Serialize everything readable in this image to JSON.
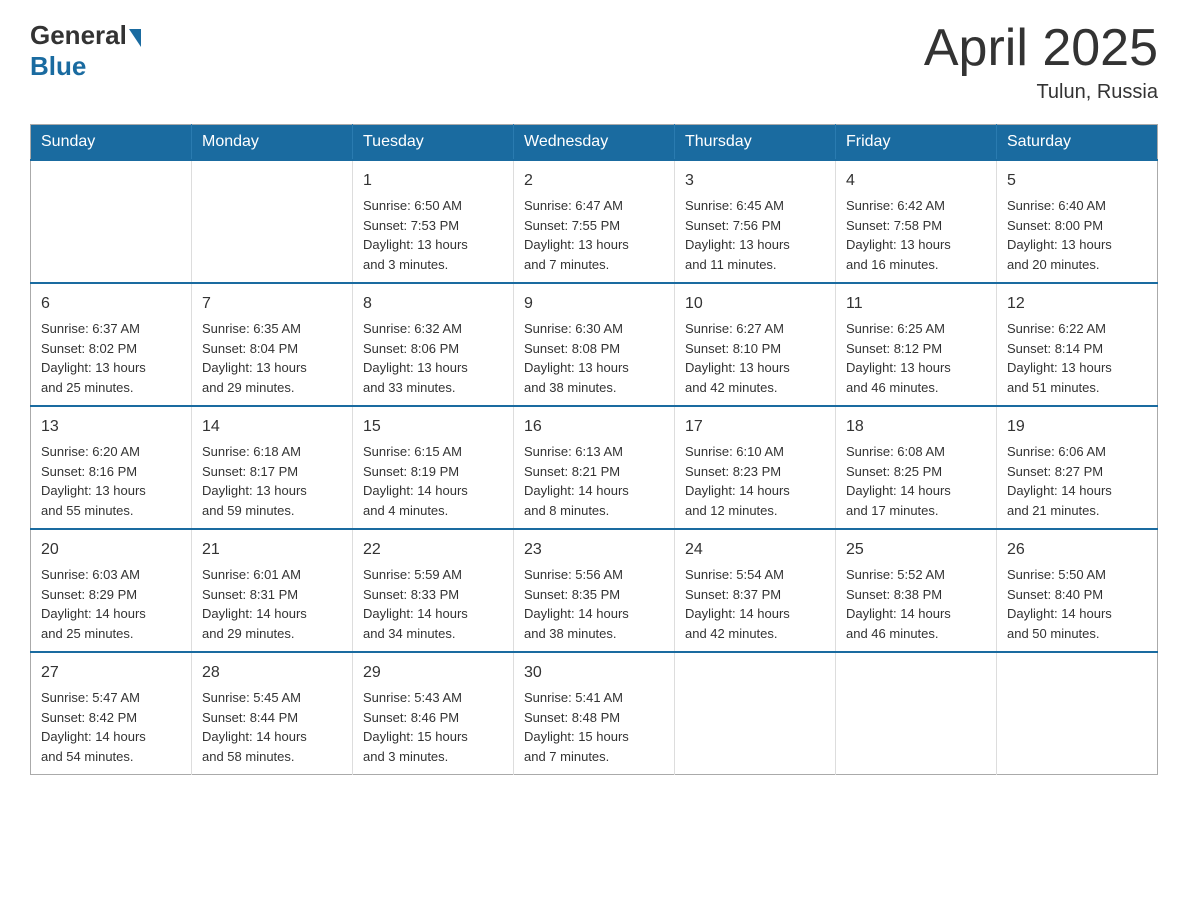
{
  "header": {
    "logo": {
      "general": "General",
      "blue": "Blue"
    },
    "title": "April 2025",
    "location": "Tulun, Russia"
  },
  "weekdays": [
    "Sunday",
    "Monday",
    "Tuesday",
    "Wednesday",
    "Thursday",
    "Friday",
    "Saturday"
  ],
  "weeks": [
    [
      {
        "day": "",
        "info": ""
      },
      {
        "day": "",
        "info": ""
      },
      {
        "day": "1",
        "info": "Sunrise: 6:50 AM\nSunset: 7:53 PM\nDaylight: 13 hours\nand 3 minutes."
      },
      {
        "day": "2",
        "info": "Sunrise: 6:47 AM\nSunset: 7:55 PM\nDaylight: 13 hours\nand 7 minutes."
      },
      {
        "day": "3",
        "info": "Sunrise: 6:45 AM\nSunset: 7:56 PM\nDaylight: 13 hours\nand 11 minutes."
      },
      {
        "day": "4",
        "info": "Sunrise: 6:42 AM\nSunset: 7:58 PM\nDaylight: 13 hours\nand 16 minutes."
      },
      {
        "day": "5",
        "info": "Sunrise: 6:40 AM\nSunset: 8:00 PM\nDaylight: 13 hours\nand 20 minutes."
      }
    ],
    [
      {
        "day": "6",
        "info": "Sunrise: 6:37 AM\nSunset: 8:02 PM\nDaylight: 13 hours\nand 25 minutes."
      },
      {
        "day": "7",
        "info": "Sunrise: 6:35 AM\nSunset: 8:04 PM\nDaylight: 13 hours\nand 29 minutes."
      },
      {
        "day": "8",
        "info": "Sunrise: 6:32 AM\nSunset: 8:06 PM\nDaylight: 13 hours\nand 33 minutes."
      },
      {
        "day": "9",
        "info": "Sunrise: 6:30 AM\nSunset: 8:08 PM\nDaylight: 13 hours\nand 38 minutes."
      },
      {
        "day": "10",
        "info": "Sunrise: 6:27 AM\nSunset: 8:10 PM\nDaylight: 13 hours\nand 42 minutes."
      },
      {
        "day": "11",
        "info": "Sunrise: 6:25 AM\nSunset: 8:12 PM\nDaylight: 13 hours\nand 46 minutes."
      },
      {
        "day": "12",
        "info": "Sunrise: 6:22 AM\nSunset: 8:14 PM\nDaylight: 13 hours\nand 51 minutes."
      }
    ],
    [
      {
        "day": "13",
        "info": "Sunrise: 6:20 AM\nSunset: 8:16 PM\nDaylight: 13 hours\nand 55 minutes."
      },
      {
        "day": "14",
        "info": "Sunrise: 6:18 AM\nSunset: 8:17 PM\nDaylight: 13 hours\nand 59 minutes."
      },
      {
        "day": "15",
        "info": "Sunrise: 6:15 AM\nSunset: 8:19 PM\nDaylight: 14 hours\nand 4 minutes."
      },
      {
        "day": "16",
        "info": "Sunrise: 6:13 AM\nSunset: 8:21 PM\nDaylight: 14 hours\nand 8 minutes."
      },
      {
        "day": "17",
        "info": "Sunrise: 6:10 AM\nSunset: 8:23 PM\nDaylight: 14 hours\nand 12 minutes."
      },
      {
        "day": "18",
        "info": "Sunrise: 6:08 AM\nSunset: 8:25 PM\nDaylight: 14 hours\nand 17 minutes."
      },
      {
        "day": "19",
        "info": "Sunrise: 6:06 AM\nSunset: 8:27 PM\nDaylight: 14 hours\nand 21 minutes."
      }
    ],
    [
      {
        "day": "20",
        "info": "Sunrise: 6:03 AM\nSunset: 8:29 PM\nDaylight: 14 hours\nand 25 minutes."
      },
      {
        "day": "21",
        "info": "Sunrise: 6:01 AM\nSunset: 8:31 PM\nDaylight: 14 hours\nand 29 minutes."
      },
      {
        "day": "22",
        "info": "Sunrise: 5:59 AM\nSunset: 8:33 PM\nDaylight: 14 hours\nand 34 minutes."
      },
      {
        "day": "23",
        "info": "Sunrise: 5:56 AM\nSunset: 8:35 PM\nDaylight: 14 hours\nand 38 minutes."
      },
      {
        "day": "24",
        "info": "Sunrise: 5:54 AM\nSunset: 8:37 PM\nDaylight: 14 hours\nand 42 minutes."
      },
      {
        "day": "25",
        "info": "Sunrise: 5:52 AM\nSunset: 8:38 PM\nDaylight: 14 hours\nand 46 minutes."
      },
      {
        "day": "26",
        "info": "Sunrise: 5:50 AM\nSunset: 8:40 PM\nDaylight: 14 hours\nand 50 minutes."
      }
    ],
    [
      {
        "day": "27",
        "info": "Sunrise: 5:47 AM\nSunset: 8:42 PM\nDaylight: 14 hours\nand 54 minutes."
      },
      {
        "day": "28",
        "info": "Sunrise: 5:45 AM\nSunset: 8:44 PM\nDaylight: 14 hours\nand 58 minutes."
      },
      {
        "day": "29",
        "info": "Sunrise: 5:43 AM\nSunset: 8:46 PM\nDaylight: 15 hours\nand 3 minutes."
      },
      {
        "day": "30",
        "info": "Sunrise: 5:41 AM\nSunset: 8:48 PM\nDaylight: 15 hours\nand 7 minutes."
      },
      {
        "day": "",
        "info": ""
      },
      {
        "day": "",
        "info": ""
      },
      {
        "day": "",
        "info": ""
      }
    ]
  ]
}
